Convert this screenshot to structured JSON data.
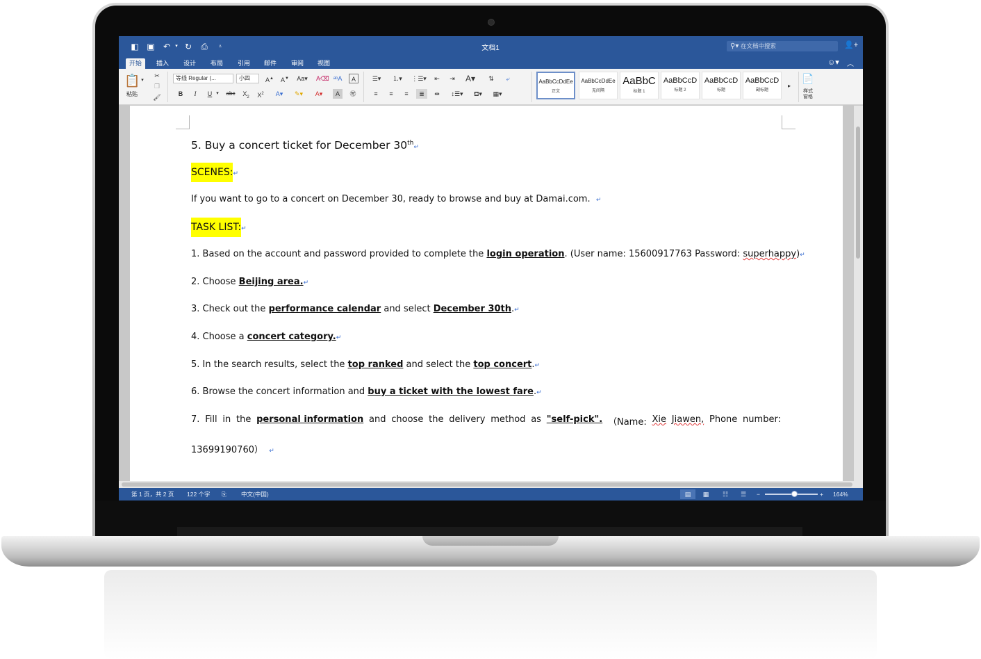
{
  "window": {
    "doc_title": "文档1",
    "search_placeholder": "在文档中搜索"
  },
  "ribbon_tabs": [
    "开始",
    "插入",
    "设计",
    "布局",
    "引用",
    "邮件",
    "审阅",
    "视图"
  ],
  "ribbon": {
    "paste_label": "粘贴",
    "font_name": "等线 Regular (...",
    "font_size": "小四",
    "styles": [
      {
        "sample": "AaBbCcDdEe",
        "name": "正文"
      },
      {
        "sample": "AaBbCcDdEe",
        "name": "无间隔"
      },
      {
        "sample": "AaBbC",
        "name": "标题 1"
      },
      {
        "sample": "AaBbCcD",
        "name": "标题 2"
      },
      {
        "sample": "AaBbCcD",
        "name": "标题"
      },
      {
        "sample": "AaBbCcD",
        "name": "副标题"
      }
    ],
    "styles_pane_label": "样式\n窗格"
  },
  "document": {
    "heading_text": "5. Buy a concert ticket for December 30",
    "heading_sup": "th",
    "scenes_label": "SCENES:",
    "scenes_text": "If you want to go to a concert on December 30, ready to browse and buy at Damai.com.",
    "task_label": "TASK LIST:",
    "t1": {
      "a": "1. Based on the account and password provided to complete the ",
      "b": "login operation",
      "c": ". (User name: 15600917763 Password: ",
      "d": "superhappy",
      "e": ")"
    },
    "t2": {
      "a": "2. Choose ",
      "b": "Beijing area."
    },
    "t3": {
      "a": "3. Check out the ",
      "b": "performance calendar",
      "c": " and select ",
      "d": "December 30th",
      "e": "."
    },
    "t4": {
      "a": "4. Choose a ",
      "b": "concert category."
    },
    "t5": {
      "a": "5. In the search results, select the ",
      "b": "top ranked",
      "c": " and select the ",
      "d": "top concert",
      "e": "."
    },
    "t6": {
      "a": "6. Browse the concert information and ",
      "b": "buy a ticket with the lowest fare",
      "c": "."
    },
    "t7": {
      "w1": "7.",
      "w2": "Fill",
      "w3": "in",
      "w4": "the",
      "w5": "personal information",
      "w6": "and",
      "w7": "choose",
      "w8": "the",
      "w9": "delivery",
      "w10": "method",
      "w11": "as",
      "w12": "\"self-pick\".",
      "w13": "（Name:",
      "w14": "Xie",
      "w15": "Jiawen,",
      "w16": "Phone",
      "w17": "number:"
    },
    "t7_phone": "13699190760）",
    "para_mark": "↵"
  },
  "status": {
    "page": "第 1 页，共 2 页",
    "words": "122 个字",
    "language": "中文(中国)",
    "zoom": "164%",
    "zoom_minus": "−",
    "zoom_plus": "+"
  }
}
